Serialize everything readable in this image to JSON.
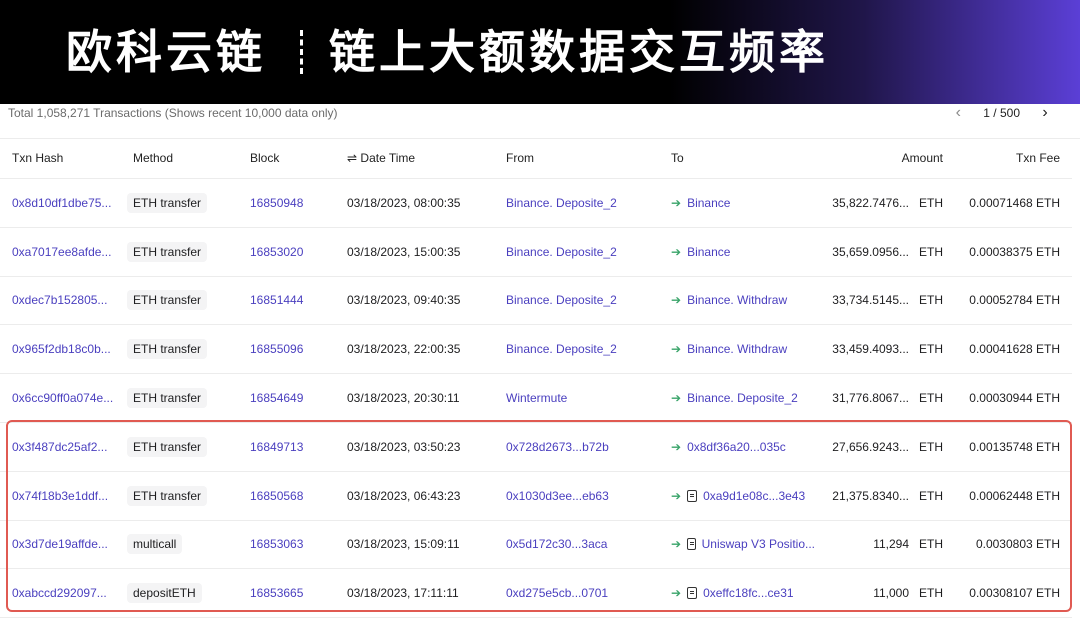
{
  "banner": {
    "brand": "欧科云链",
    "title": "链上大额数据交互频率",
    "gradient_end_color": "#5b3fd6"
  },
  "summary": {
    "text": "Total 1,058,271 Transactions (Shows recent 10,000 data only)",
    "pager": {
      "prev_icon": "chevron-left",
      "next_icon": "chevron-right",
      "page_label": "1 / 500"
    }
  },
  "columns": {
    "txn_hash": "Txn Hash",
    "method": "Method",
    "block": "Block",
    "date_time": "Date Time",
    "date_time_icon": "swap-icon",
    "from": "From",
    "to": "To",
    "amount": "Amount",
    "txn_fee": "Txn Fee"
  },
  "rows": [
    {
      "hash": "0x8d10df1dbe75...",
      "method": "ETH transfer",
      "block": "16850948",
      "time": "03/18/2023, 08:00:35",
      "from": "Binance. Deposite_2",
      "to": "Binance",
      "to_contract": false,
      "amount": "35,822.7476...",
      "unit": "ETH",
      "fee": "0.00071468 ETH"
    },
    {
      "hash": "0xa7017ee8afde...",
      "method": "ETH transfer",
      "block": "16853020",
      "time": "03/18/2023, 15:00:35",
      "from": "Binance. Deposite_2",
      "to": "Binance",
      "to_contract": false,
      "amount": "35,659.0956...",
      "unit": "ETH",
      "fee": "0.00038375 ETH"
    },
    {
      "hash": "0xdec7b152805...",
      "method": "ETH transfer",
      "block": "16851444",
      "time": "03/18/2023, 09:40:35",
      "from": "Binance. Deposite_2",
      "to": "Binance. Withdraw",
      "to_contract": false,
      "amount": "33,734.5145...",
      "unit": "ETH",
      "fee": "0.00052784 ETH"
    },
    {
      "hash": "0x965f2db18c0b...",
      "method": "ETH transfer",
      "block": "16855096",
      "time": "03/18/2023, 22:00:35",
      "from": "Binance. Deposite_2",
      "to": "Binance. Withdraw",
      "to_contract": false,
      "amount": "33,459.4093...",
      "unit": "ETH",
      "fee": "0.00041628 ETH"
    },
    {
      "hash": "0x6cc90ff0a074e...",
      "method": "ETH transfer",
      "block": "16854649",
      "time": "03/18/2023, 20:30:11",
      "from": "Wintermute",
      "to": "Binance. Deposite_2",
      "to_contract": false,
      "amount": "31,776.8067...",
      "unit": "ETH",
      "fee": "0.00030944 ETH"
    },
    {
      "hash": "0x3f487dc25af2...",
      "method": "ETH transfer",
      "block": "16849713",
      "time": "03/18/2023, 03:50:23",
      "from": "0x728d2673...b72b",
      "to": "0x8df36a20...035c",
      "to_contract": false,
      "amount": "27,656.9243...",
      "unit": "ETH",
      "fee": "0.00135748 ETH"
    },
    {
      "hash": "0x74f18b3e1ddf...",
      "method": "ETH transfer",
      "block": "16850568",
      "time": "03/18/2023, 06:43:23",
      "from": "0x1030d3ee...eb63",
      "to": "0xa9d1e08c...3e43",
      "to_contract": true,
      "amount": "21,375.8340...",
      "unit": "ETH",
      "fee": "0.00062448 ETH"
    },
    {
      "hash": "0x3d7de19affde...",
      "method": "multicall",
      "block": "16853063",
      "time": "03/18/2023, 15:09:11",
      "from": "0x5d172c30...3aca",
      "to": "Uniswap V3 Positio...",
      "to_contract": true,
      "amount": "11,294",
      "unit": "ETH",
      "fee": "0.0030803 ETH"
    },
    {
      "hash": "0xabccd292097...",
      "method": "depositETH",
      "block": "16853665",
      "time": "03/18/2023, 17:11:11",
      "from": "0xd275e5cb...0701",
      "to": "0xeffc18fc...ce31",
      "to_contract": true,
      "amount": "11,000",
      "unit": "ETH",
      "fee": "0.00308107 ETH"
    }
  ],
  "colors": {
    "link": "#4a3fbf",
    "arrow": "#3aa46a",
    "highlight": "#e05a52"
  }
}
